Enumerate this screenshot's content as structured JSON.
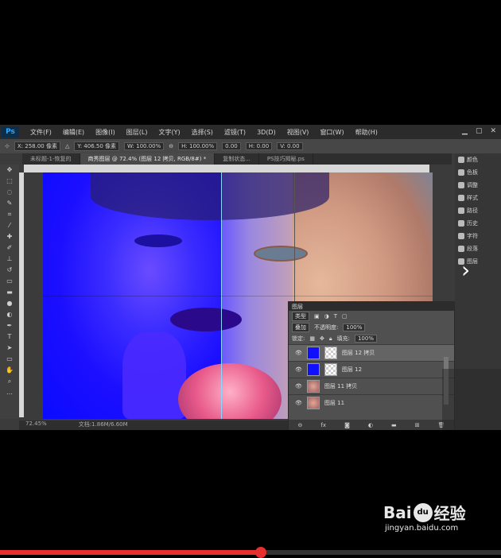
{
  "app": {
    "logo": "Ps",
    "menu": [
      "文件(F)",
      "编辑(E)",
      "图像(I)",
      "图层(L)",
      "文字(Y)",
      "选择(S)",
      "滤镜(T)",
      "3D(D)",
      "视图(V)",
      "窗口(W)",
      "帮助(H)"
    ]
  },
  "options": {
    "x": "X: 258.00 像素",
    "y": "Y: 406.50 像素",
    "w": "W: 100.00%",
    "h": "H: 100.00%",
    "angle": "0.00",
    "hskew": "H: 0.00",
    "vskew": "V: 0.00"
  },
  "tabs": [
    "未标题-1-恢复的",
    "商秀图层 @ 72.4% (图层 12 拷贝, RGB/8#) *",
    "复制状态...",
    "PS技巧揭秘.ps"
  ],
  "status": {
    "zoom": "72.45%",
    "doc": "文档:1.86M/6.60M"
  },
  "dock": [
    "颜色",
    "色板",
    "调整",
    "样式",
    "路径",
    "历史",
    "字符",
    "段落",
    "图层"
  ],
  "layers": {
    "title": "图层",
    "filter": "类型",
    "blend_mode": "叠加",
    "opacity_label": "不透明度:",
    "opacity": "100%",
    "lock_label": "锁定:",
    "fill_label": "填充:",
    "fill": "100%",
    "items": [
      {
        "name": "图层 12 拷贝",
        "thumb": "blue",
        "active": true
      },
      {
        "name": "图层 12",
        "thumb": "blue",
        "active": false
      },
      {
        "name": "图层 11 拷贝",
        "thumb": "face",
        "active": false
      },
      {
        "name": "图层 11",
        "thumb": "face",
        "active": false
      }
    ]
  },
  "watermark": {
    "brand": "Bai",
    "brand_suffix": "经验",
    "url": "jingyan.baidu.com"
  },
  "video": {
    "progress": 0.52,
    "color": "#e63030"
  }
}
